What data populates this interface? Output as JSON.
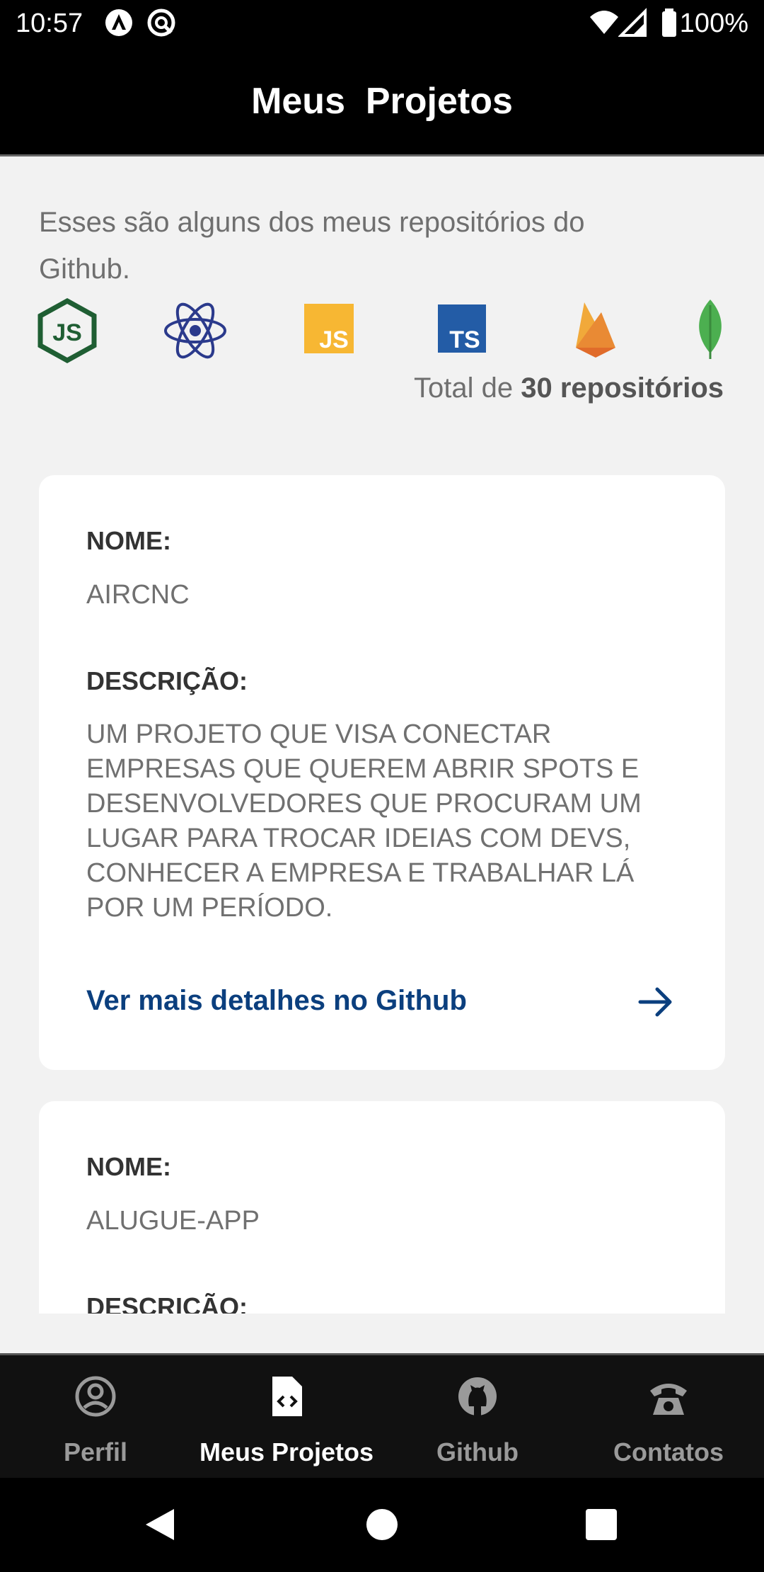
{
  "status_bar": {
    "time": "10:57",
    "battery": "100%"
  },
  "header": {
    "title": "Meus  Projetos"
  },
  "intro": {
    "text": "Esses são alguns dos meus repositórios do Github.",
    "total_prefix": "Total de ",
    "total_bold": "30 repositórios"
  },
  "tech_icons": [
    "nodejs-icon",
    "react-icon",
    "javascript-icon",
    "typescript-icon",
    "firebase-icon",
    "mongodb-icon"
  ],
  "projects": [
    {
      "name_label": "NOME:",
      "name": "AIRCNC",
      "desc_label": "DESCRIÇÃO:",
      "description": "UM PROJETO QUE VISA CONECTAR EMPRESAS QUE QUEREM ABRIR SPOTS E DESENVOLVEDORES QUE PROCURAM UM LUGAR PARA TROCAR IDEIAS COM DEVS, CONHECER A EMPRESA E TRABALHAR LÁ POR UM PERÍODO.",
      "link": "Ver mais detalhes no Github"
    },
    {
      "name_label": "NOME:",
      "name": "ALUGUE-APP",
      "desc_label": "DESCRIÇÃO:"
    }
  ],
  "bottom_nav": [
    {
      "label": "Perfil",
      "icon": "profile-icon",
      "active": false
    },
    {
      "label": "Meus Projetos",
      "icon": "code-file-icon",
      "active": true
    },
    {
      "label": "Github",
      "icon": "github-icon",
      "active": false
    },
    {
      "label": "Contatos",
      "icon": "phone-icon",
      "active": false
    }
  ],
  "colors": {
    "link": "#0b3f7e",
    "header_bg": "#000000",
    "content_bg": "#f2f2f2",
    "nav_bg": "#111111"
  }
}
